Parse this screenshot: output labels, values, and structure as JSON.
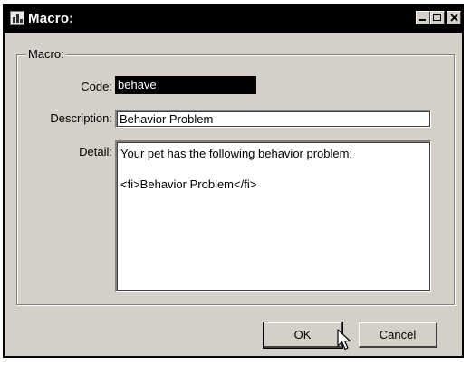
{
  "window": {
    "title": "Macro:",
    "icon": "app-chart-icon",
    "controls": [
      "minimize-icon",
      "maximize-icon",
      "close-icon"
    ]
  },
  "group": {
    "label": "Macro:"
  },
  "fields": {
    "code_label": "Code:",
    "code_value": "behave",
    "description_label": "Description:",
    "description_value": "Behavior Problem",
    "detail_label": "Detail:",
    "detail_lines": [
      "Your pet has the following behavior problem:",
      "",
      "<fi>Behavior Problem</fi>"
    ]
  },
  "buttons": {
    "ok_label": "OK",
    "cancel_label": "Cancel"
  },
  "colors": {
    "titlebar": "#000000",
    "dialog_face": "#d4d0c8",
    "code_field_bg": "#000000",
    "code_field_text": "#ffffff"
  }
}
